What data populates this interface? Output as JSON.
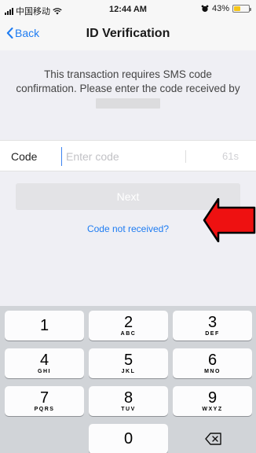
{
  "status_bar": {
    "carrier": "中国移动",
    "wifi_icon": "wifi-icon",
    "time": "12:44 AM",
    "alarm_icon": "alarm-icon",
    "battery_text": "43%",
    "battery_level": 0.43,
    "battery_color": "#f5c518"
  },
  "nav": {
    "back_label": "Back",
    "title": "ID Verification",
    "accent_color": "#1e7cf2"
  },
  "message": {
    "text": "This transaction requires SMS code confirmation. Please enter the code received by"
  },
  "code_field": {
    "label": "Code",
    "placeholder": "Enter code",
    "value": "",
    "timer": "61s"
  },
  "next_button": {
    "label": "Next"
  },
  "code_not_received": {
    "label": "Code not received?"
  },
  "annotation": {
    "arrow_color": "#ee1111"
  },
  "keypad": {
    "keys": [
      {
        "digit": "1",
        "letters": ""
      },
      {
        "digit": "2",
        "letters": "ABC"
      },
      {
        "digit": "3",
        "letters": "DEF"
      },
      {
        "digit": "4",
        "letters": "GHI"
      },
      {
        "digit": "5",
        "letters": "JKL"
      },
      {
        "digit": "6",
        "letters": "MNO"
      },
      {
        "digit": "7",
        "letters": "PQRS"
      },
      {
        "digit": "8",
        "letters": "TUV"
      },
      {
        "digit": "9",
        "letters": "WXYZ"
      },
      {
        "digit": "0",
        "letters": ""
      }
    ],
    "delete_icon": "backspace-icon"
  }
}
